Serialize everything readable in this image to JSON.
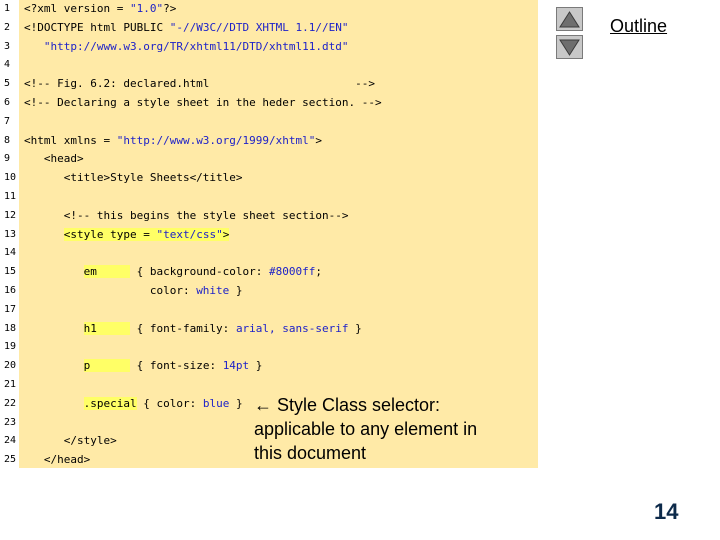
{
  "code": {
    "lines": [
      {
        "n": "1",
        "parts": [
          {
            "t": "<?xml version = "
          },
          {
            "t": "\"1.0\"",
            "c": "lit"
          },
          {
            "t": "?>"
          }
        ]
      },
      {
        "n": "2",
        "parts": [
          {
            "t": "<!DOCTYPE html PUBLIC "
          },
          {
            "t": "\"-//W3C//DTD XHTML 1.1//EN\"",
            "c": "lit"
          }
        ]
      },
      {
        "n": "3",
        "parts": [
          {
            "t": "   "
          },
          {
            "t": "\"http://www.w3.org/TR/xhtml11/DTD/xhtml11.dtd\"",
            "c": "lit"
          }
        ]
      },
      {
        "n": "4",
        "parts": []
      },
      {
        "n": "5",
        "parts": [
          {
            "t": "<!-- Fig. 6.2: declared.html                      -->"
          }
        ]
      },
      {
        "n": "6",
        "parts": [
          {
            "t": "<!-- Declaring a style sheet in the heder section. -->"
          }
        ]
      },
      {
        "n": "7",
        "parts": []
      },
      {
        "n": "8",
        "parts": [
          {
            "t": "<html xmlns = "
          },
          {
            "t": "\"http://www.w3.org/1999/xhtml\"",
            "c": "lit"
          },
          {
            "t": ">"
          }
        ]
      },
      {
        "n": "9",
        "parts": [
          {
            "t": "   <head>"
          }
        ]
      },
      {
        "n": "10",
        "parts": [
          {
            "t": "      <title>Style Sheets</title>"
          }
        ]
      },
      {
        "n": "11",
        "parts": []
      },
      {
        "n": "12",
        "parts": [
          {
            "t": "      <!-- this begins the style sheet section-->"
          }
        ]
      },
      {
        "n": "13",
        "parts": [
          {
            "t": "      "
          },
          {
            "t": "<style type = ",
            "c": "hl"
          },
          {
            "t": "\"text/css\"",
            "c": "lit hl"
          },
          {
            "t": ">",
            "c": "hl"
          }
        ]
      },
      {
        "n": "14",
        "parts": []
      },
      {
        "n": "15",
        "parts": [
          {
            "t": "         "
          },
          {
            "t": "em     ",
            "c": "hl"
          },
          {
            "t": " { background-color: "
          },
          {
            "t": "#8000ff",
            "c": "lit"
          },
          {
            "t": ";"
          }
        ]
      },
      {
        "n": "16",
        "parts": [
          {
            "t": "                   color: "
          },
          {
            "t": "white",
            "c": "lit"
          },
          {
            "t": " }"
          }
        ]
      },
      {
        "n": "17",
        "parts": []
      },
      {
        "n": "18",
        "parts": [
          {
            "t": "         "
          },
          {
            "t": "h1     ",
            "c": "hl"
          },
          {
            "t": " { font-family: "
          },
          {
            "t": "arial, sans-serif",
            "c": "lit"
          },
          {
            "t": " }"
          }
        ]
      },
      {
        "n": "19",
        "parts": []
      },
      {
        "n": "20",
        "parts": [
          {
            "t": "         "
          },
          {
            "t": "p      ",
            "c": "hl"
          },
          {
            "t": " { font-size: "
          },
          {
            "t": "14pt",
            "c": "lit"
          },
          {
            "t": " }"
          }
        ]
      },
      {
        "n": "21",
        "parts": []
      },
      {
        "n": "22",
        "parts": [
          {
            "t": "         "
          },
          {
            "t": ".special",
            "c": "hl"
          },
          {
            "t": " { color: "
          },
          {
            "t": "blue",
            "c": "lit"
          },
          {
            "t": " }"
          }
        ]
      },
      {
        "n": "23",
        "parts": []
      },
      {
        "n": "24",
        "parts": [
          {
            "t": "      </style>"
          }
        ]
      },
      {
        "n": "25",
        "parts": [
          {
            "t": "   </head>"
          }
        ]
      }
    ]
  },
  "nav": {
    "up_icon": "triangle-up-icon",
    "down_icon": "triangle-down-icon"
  },
  "outline_label": "Outline",
  "annotation": {
    "arrow_icon": "left-arrow-icon",
    "lines": [
      "← Style Class selector:",
      "applicable to any element in",
      "this document"
    ]
  },
  "page_number": "14",
  "colors": {
    "code_background": "#ffeaa7",
    "highlight": "#ffff66",
    "literal": "#1e22c8",
    "page_number": "#0d2a4a"
  }
}
